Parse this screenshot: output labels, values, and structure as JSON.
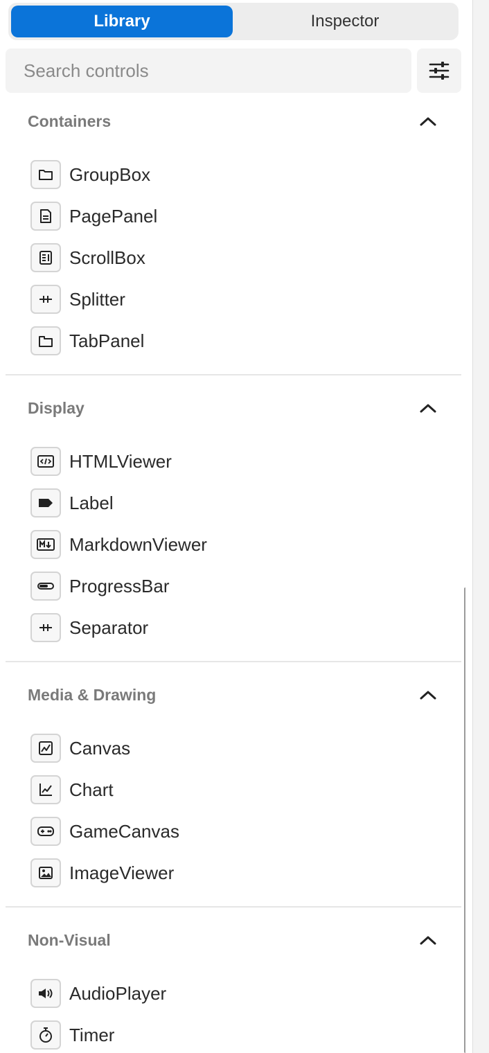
{
  "tabs": {
    "library": "Library",
    "inspector": "Inspector"
  },
  "search": {
    "placeholder": "Search controls"
  },
  "sections": [
    {
      "title": "Containers",
      "items": [
        {
          "label": "GroupBox",
          "icon": "folder-icon"
        },
        {
          "label": "PagePanel",
          "icon": "page-icon"
        },
        {
          "label": "ScrollBox",
          "icon": "scrollbox-icon"
        },
        {
          "label": "Splitter",
          "icon": "splitter-icon"
        },
        {
          "label": "TabPanel",
          "icon": "tabpanel-icon"
        }
      ]
    },
    {
      "title": "Display",
      "items": [
        {
          "label": "HTMLViewer",
          "icon": "code-icon"
        },
        {
          "label": "Label",
          "icon": "label-icon"
        },
        {
          "label": "MarkdownViewer",
          "icon": "markdown-icon"
        },
        {
          "label": "ProgressBar",
          "icon": "progressbar-icon"
        },
        {
          "label": "Separator",
          "icon": "separator-icon"
        }
      ]
    },
    {
      "title": "Media & Drawing",
      "items": [
        {
          "label": "Canvas",
          "icon": "canvas-icon"
        },
        {
          "label": "Chart",
          "icon": "chart-icon"
        },
        {
          "label": "GameCanvas",
          "icon": "gamepad-icon"
        },
        {
          "label": "ImageViewer",
          "icon": "image-icon"
        }
      ]
    },
    {
      "title": "Non-Visual",
      "items": [
        {
          "label": "AudioPlayer",
          "icon": "speaker-icon"
        },
        {
          "label": "Timer",
          "icon": "stopwatch-icon"
        }
      ]
    }
  ],
  "colors": {
    "accent": "#0b74d9"
  }
}
